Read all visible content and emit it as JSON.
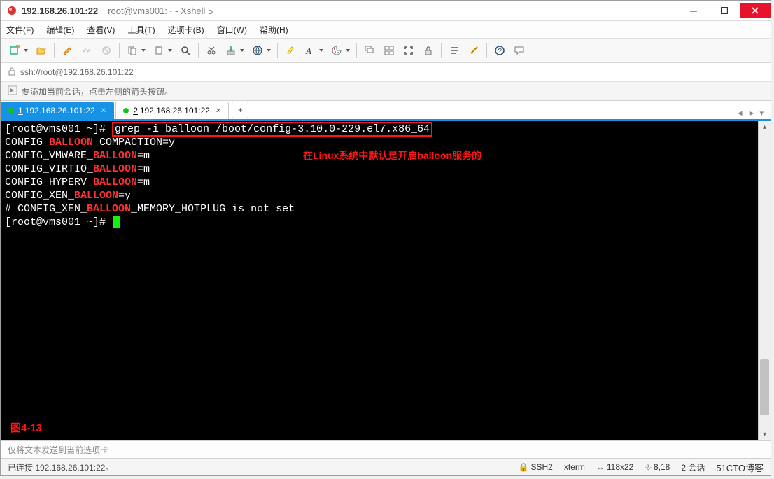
{
  "title": {
    "host": "192.168.26.101:22",
    "session": "root@vms001:~ - Xshell 5"
  },
  "menu": {
    "file": "文件(F)",
    "edit": "编辑(E)",
    "view": "查看(V)",
    "tools": "工具(T)",
    "tabs": "选项卡(B)",
    "window": "窗口(W)",
    "help": "帮助(H)"
  },
  "toolbar_icons": {
    "new": "new-session-icon",
    "folder": "folder-open-icon",
    "pen": "edit-icon",
    "link": "link-icon",
    "disconnect": "disconnect-icon",
    "copy": "copy-icon",
    "paste": "paste-icon",
    "find": "search-icon",
    "cut": "scissors-icon",
    "transfer": "transfer-icon",
    "globe": "globe-icon",
    "marker": "highlight-icon",
    "font": "font-icon",
    "palette": "palette-icon",
    "cascade": "cascade-icon",
    "tile": "tile-icon",
    "full": "fullscreen-icon",
    "lock": "lock-icon",
    "align": "align-icon",
    "wand": "wand-icon",
    "help": "help-icon",
    "chat": "chat-icon"
  },
  "url": {
    "text": "ssh://root@192.168.26.101:22"
  },
  "info": {
    "text": "要添加当前会话，点击左侧的箭头按钮。"
  },
  "tabs": {
    "active": {
      "num": "1",
      "label": "192.168.26.101:22"
    },
    "other": {
      "num": "2",
      "label": "192.168.26.101:22"
    },
    "add": "+"
  },
  "terminal": {
    "prompt": "[root@vms001 ~]#",
    "command": "grep -i balloon /boot/config-3.10.0-229.el7.x86_64",
    "lines": [
      {
        "pre": "CONFIG_",
        "hl": "BALLOON",
        "post": "_COMPACTION=y"
      },
      {
        "pre": "CONFIG_VMWARE_",
        "hl": "BALLOON",
        "post": "=m"
      },
      {
        "pre": "CONFIG_VIRTIO_",
        "hl": "BALLOON",
        "post": "=m"
      },
      {
        "pre": "CONFIG_HYPERV_",
        "hl": "BALLOON",
        "post": "=m"
      },
      {
        "pre": "CONFIG_XEN_",
        "hl": "BALLOON",
        "post": "=y"
      },
      {
        "pre": "# CONFIG_XEN_",
        "hl": "BALLOON",
        "post": "_MEMORY_HOTPLUG is not set"
      }
    ],
    "note": "在Linux系统中默认是开启balloon服务的",
    "figure": "图4-13"
  },
  "sendline": {
    "placeholder": "仅将文本发送到当前选项卡"
  },
  "status": {
    "connected": "已连接 192.168.26.101:22。",
    "proto": "SSH2",
    "emul": "xterm",
    "size": "118x22",
    "pos": "8,18",
    "sessions": "2 会话",
    "watermark": "51CTO博客"
  }
}
